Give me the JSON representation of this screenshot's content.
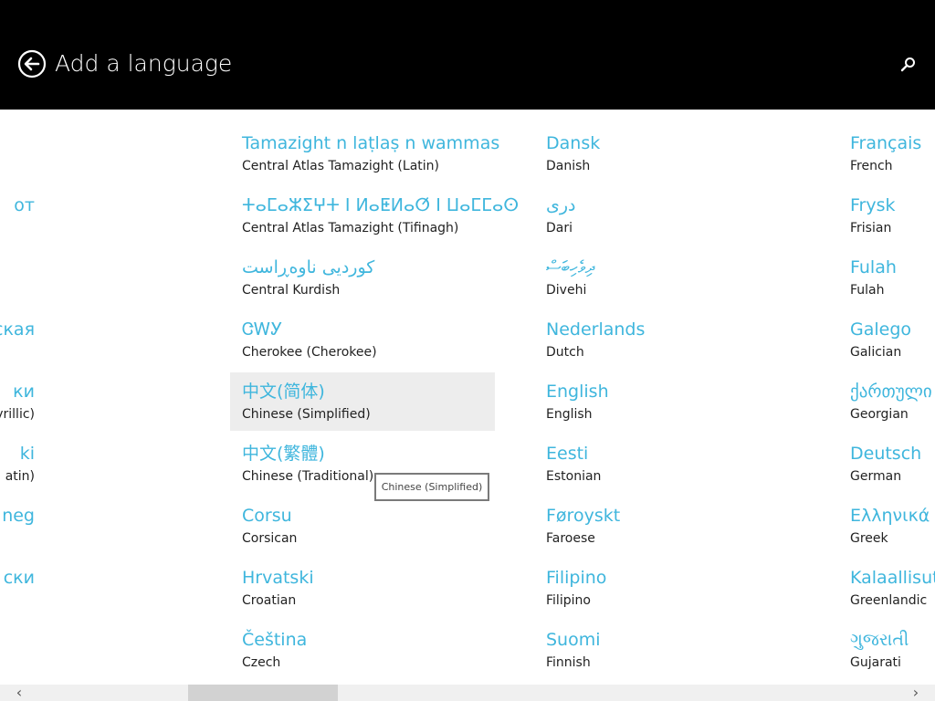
{
  "header": {
    "title": "Add a language",
    "back_icon": "back-arrow-circle-icon",
    "search_icon": "search-icon"
  },
  "tooltip": "Chinese (Simplified)",
  "colors": {
    "accent": "#3fb6dd",
    "header_bg": "#000000",
    "selected_bg": "#ededed"
  },
  "columns": [
    {
      "items": [
        {
          "native": "",
          "english": ""
        },
        {
          "native": "от",
          "english": ""
        },
        {
          "native": "",
          "english": ""
        },
        {
          "native": "ская",
          "english": ""
        },
        {
          "native": "ки",
          "english": "yrillic)"
        },
        {
          "native": "ki",
          "english": "atin)"
        },
        {
          "native": "neg",
          "english": ""
        },
        {
          "native": "ски",
          "english": ""
        },
        {
          "native": "",
          "english": ""
        }
      ]
    },
    {
      "items": [
        {
          "native": "Tamazight n laṭlaṣ n wammas",
          "english": "Central Atlas Tamazight (Latin)"
        },
        {
          "native": "ⵜⴰⵎⴰⵣⵉⵖⵜ ⵏ ⵍⴰⵟⵍⴰⵚ ⵏ ⵡⴰⵎⵎⴰⵙ",
          "english": "Central Atlas Tamazight (Tifinagh)"
        },
        {
          "native": "کوردیی ناوەڕاست",
          "english": "Central Kurdish"
        },
        {
          "native": "ᏣᎳᎩ",
          "english": "Cherokee (Cherokee)"
        },
        {
          "native": "中文(简体)",
          "english": "Chinese (Simplified)"
        },
        {
          "native": "中文(繁體)",
          "english": "Chinese (Traditional)"
        },
        {
          "native": "Corsu",
          "english": "Corsican"
        },
        {
          "native": "Hrvatski",
          "english": "Croatian"
        },
        {
          "native": "Čeština",
          "english": "Czech"
        }
      ]
    },
    {
      "items": [
        {
          "native": "Dansk",
          "english": "Danish"
        },
        {
          "native": "دری",
          "english": "Dari"
        },
        {
          "native": "ދިވެހިބަސް",
          "english": "Divehi"
        },
        {
          "native": "Nederlands",
          "english": "Dutch"
        },
        {
          "native": "English",
          "english": "English"
        },
        {
          "native": "Eesti",
          "english": "Estonian"
        },
        {
          "native": "Føroyskt",
          "english": "Faroese"
        },
        {
          "native": "Filipino",
          "english": "Filipino"
        },
        {
          "native": "Suomi",
          "english": "Finnish"
        }
      ]
    },
    {
      "items": [
        {
          "native": "Français",
          "english": "French"
        },
        {
          "native": "Frysk",
          "english": "Frisian"
        },
        {
          "native": "Fulah",
          "english": "Fulah"
        },
        {
          "native": "Galego",
          "english": "Galician"
        },
        {
          "native": "ქართული",
          "english": "Georgian"
        },
        {
          "native": "Deutsch",
          "english": "German"
        },
        {
          "native": "Ελληνικά",
          "english": "Greek"
        },
        {
          "native": "Kalaallisut",
          "english": "Greenlandic"
        },
        {
          "native": "ગુજરાતી",
          "english": "Gujarati"
        }
      ]
    }
  ],
  "scrollbar": {
    "left_icon": "chevron-left-icon",
    "right_icon": "chevron-right-icon",
    "left_glyph": "‹",
    "right_glyph": "›"
  }
}
